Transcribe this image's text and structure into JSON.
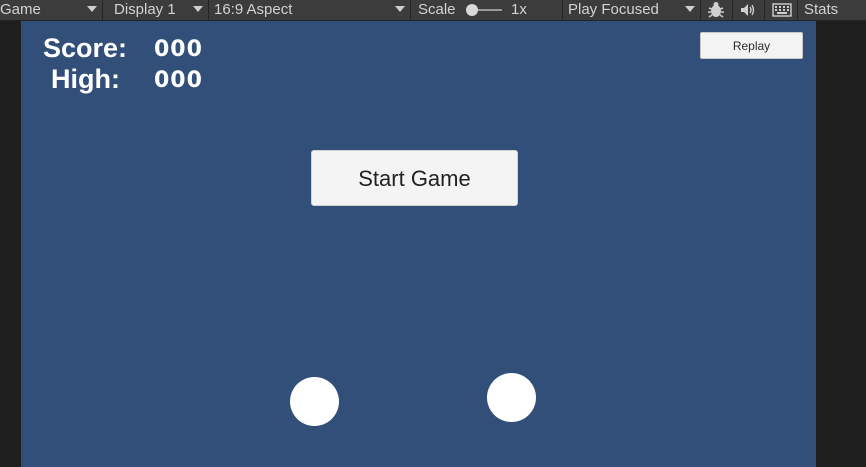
{
  "toolbar": {
    "game_tab": "Game",
    "display": "Display 1",
    "aspect": "16:9 Aspect",
    "scale_label": "Scale",
    "scale_value": "1x",
    "play_mode": "Play Focused",
    "stats": "Stats",
    "icons": [
      "bug-icon",
      "audio-icon",
      "keyboard-icon"
    ]
  },
  "game": {
    "background": "#324f79",
    "score_label": "Score:",
    "score_value": "000",
    "high_label": "High:",
    "high_value": "000",
    "replay_label": "Replay",
    "start_label": "Start Game"
  }
}
